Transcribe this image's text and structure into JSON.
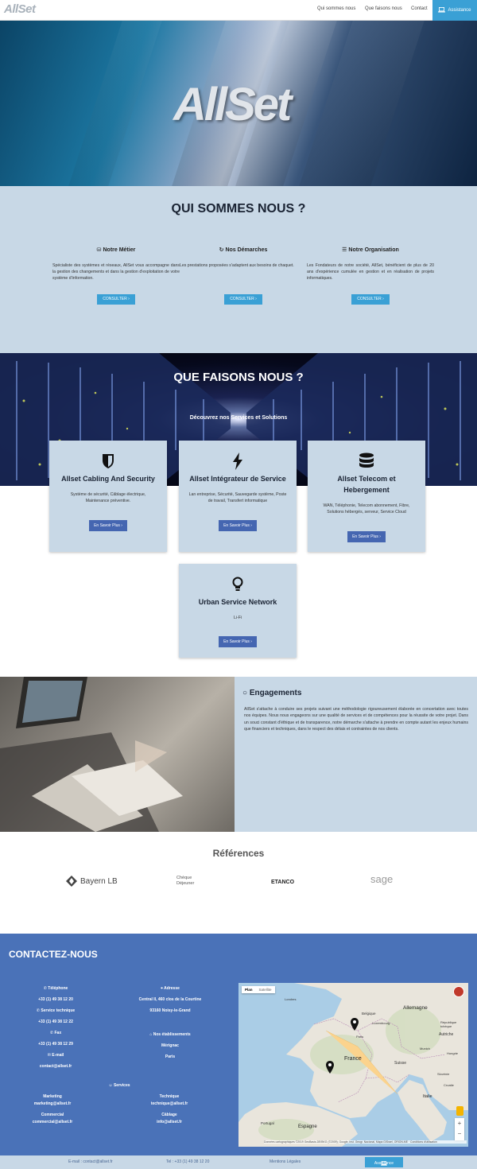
{
  "nav": {
    "logo": "AllSet",
    "links": [
      "Qui sommes nous",
      "Que faisons nous",
      "Contact"
    ],
    "assistance": "Assistance"
  },
  "hero": {
    "logo": "AllSet"
  },
  "qui": {
    "title": "QUI SOMMES NOUS ?",
    "cols": [
      {
        "title": "Notre Métier",
        "text": "Spécialiste des systèmes et réseaux, AllSet vous accompagne dans la gestion des changements et dans la gestion d'exploitation de votre système d'information.",
        "button": "CONSULTER ›"
      },
      {
        "title": "Nos Démarches",
        "text": "Les prestations proposées s'adaptent aux besoins de chaquet.",
        "button": "CONSULTER ›"
      },
      {
        "title": "Notre Organisation",
        "text": "Les Fondateurs de notre société, AllSet, bénéficient de plus de 20 ans d'expérience cumulée en gestion et en réalisation de projets informatiques.",
        "button": "CONSULTER ›"
      }
    ]
  },
  "services": {
    "title": "QUE FAISONS NOUS ?",
    "subtitle": "Découvrez nos Services et Solutions",
    "cards": [
      {
        "title": "Allset Cabling And Security",
        "desc": "Système de sécurité, Câblage électrique, Maintenance préventive.",
        "button": "En Savoir Plus ›",
        "icon": "shield-icon"
      },
      {
        "title": "Allset Intégrateur de Service",
        "desc": "Lan entreprise, Sécurité, Sauvegarde système, Poste de travail, Transfert informatique",
        "button": "En Savoir Plus ›",
        "icon": "bolt-icon"
      },
      {
        "title": "Allset Telecom et Hebergement",
        "desc": "WAN, Téléphonie, Telecom abonnement, Fibre, Solutions hébergés, serveur, Service Cloud",
        "button": "En Savoir Plus ›",
        "icon": "database-icon"
      },
      {
        "title": "Urban Service Network",
        "desc": "Li-Fi",
        "button": "En Savoir Plus ›",
        "icon": "lightbulb-icon"
      }
    ]
  },
  "engagements": {
    "title": "Engagements",
    "text": "AllSet s'attache à conduire ses projets suivant une méthodologie rigoureusement élaborée en concertation avec toutes nos équipes. Nous nous engageons sur une qualité de services et de compétences pour la réussite de votre projet. Dans un souci constant d'éthique et de transparence, notre démarche s'attache à prendre en compte autant les enjeux humains que financiers et techniques, dans le respect des délais et contraintes de nos clients."
  },
  "references": {
    "title": "Références",
    "logos": [
      "Bayern LB",
      "Chèque",
      "Déjeuner",
      "ETANCO",
      "sage"
    ]
  },
  "contact": {
    "title": "CONTACTEZ-NOUS",
    "phone_label": "Téléphone",
    "phone": "+33 (1) 49 38 12 20",
    "tech_label": "Service technique",
    "tech_phone": "+33 (1) 49 38 12 22",
    "fax_label": "Fax",
    "fax": "+33 (1) 49 38 12 29",
    "email_label": "E-mail",
    "email": "contact@allset.fr",
    "address_label": "Adresse",
    "address1": "Central II, 460 clos de la Courtine",
    "address2": "93160 Noisy-le-Grand",
    "estab_label": "Nos établissements",
    "estab1": "Mérignac",
    "estab2": "Paris",
    "services_label": "Services",
    "marketing_label": "Marketing",
    "marketing_email": "marketing@allset.fr",
    "commercial_label": "Commercial",
    "commercial_email": "commercial@allset.fr",
    "technique_label": "Technique",
    "technique_email": "technique@allset.fr",
    "cablage_label": "Câblage",
    "cablage_email": "info@allset.fr",
    "map": {
      "tab_plan": "Plan",
      "tab_sat": "Satellite",
      "labels": [
        "Allemagne",
        "Belgique",
        "Luxembourg",
        "Paris",
        "France",
        "Suisse",
        "Autriche",
        "République tchèque",
        "Espagne",
        "Portugal",
        "Italie",
        "Hongrie",
        "Slovénie",
        "Croatie",
        "Londres",
        "Munich"
      ],
      "attribution": "Données cartographiques ©2019 GeoBasis-DE/BKG (©2009), Google, Inst. Geogr. Nacional, Mapa GISrael, ORION-ME · Conditions d'utilisation"
    }
  },
  "footer": {
    "email": "E-mail : contact@allset.fr",
    "tel": "Tel : +33 (1) 49 38 12 20",
    "legal": "Mentions Légales",
    "assistance": "Assistance"
  },
  "colors": {
    "accent": "#3aa0d5",
    "panel": "#c8d8e6",
    "contact_bg": "#4a72b8",
    "button": "#4566b1"
  }
}
